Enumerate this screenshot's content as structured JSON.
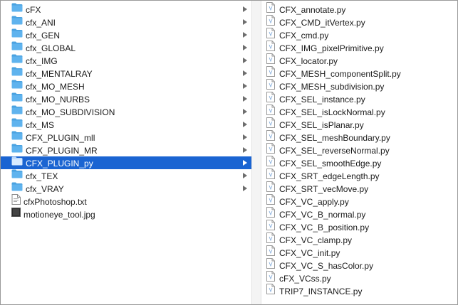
{
  "left_column": {
    "items": [
      {
        "label": "cFX",
        "type": "folder"
      },
      {
        "label": "cfx_ANI",
        "type": "folder"
      },
      {
        "label": "cfx_GEN",
        "type": "folder"
      },
      {
        "label": "cfx_GLOBAL",
        "type": "folder"
      },
      {
        "label": "cfx_IMG",
        "type": "folder"
      },
      {
        "label": "cfx_MENTALRAY",
        "type": "folder"
      },
      {
        "label": "cfx_MO_MESH",
        "type": "folder"
      },
      {
        "label": "cfx_MO_NURBS",
        "type": "folder"
      },
      {
        "label": "cfx_MO_SUBDIVISION",
        "type": "folder"
      },
      {
        "label": "cfx_MS",
        "type": "folder"
      },
      {
        "label": "CFX_PLUGIN_mll",
        "type": "folder"
      },
      {
        "label": "CFX_PLUGIN_MR",
        "type": "folder"
      },
      {
        "label": "CFX_PLUGIN_py",
        "type": "folder",
        "selected": true
      },
      {
        "label": "cfx_TEX",
        "type": "folder"
      },
      {
        "label": "cfx_VRAY",
        "type": "folder"
      },
      {
        "label": "cfxPhotoshop.txt",
        "type": "text-file"
      },
      {
        "label": "motioneye_tool.jpg",
        "type": "image-file"
      }
    ]
  },
  "right_column": {
    "items": [
      "CFX_annotate.py",
      "CFX_CMD_itVertex.py",
      "CFX_cmd.py",
      "CFX_IMG_pixelPrimitive.py",
      "CFX_locator.py",
      "CFX_MESH_componentSplit.py",
      "CFX_MESH_subdivision.py",
      "CFX_SEL_instance.py",
      "CFX_SEL_isLockNormal.py",
      "CFX_SEL_isPlanar.py",
      "CFX_SEL_meshBoundary.py",
      "CFX_SEL_reverseNormal.py",
      "CFX_SEL_smoothEdge.py",
      "CFX_SRT_edgeLength.py",
      "CFX_SRT_vecMove.py",
      "CFX_VC_apply.py",
      "CFX_VC_B_normal.py",
      "CFX_VC_B_position.py",
      "CFX_VC_clamp.py",
      "CFX_VC_init.py",
      "CFX_VC_S_hasColor.py",
      "cFX_VCss.py",
      "TRIP7_INSTANCE.py"
    ]
  },
  "colors": {
    "selection": "#1a64d2",
    "folder_body": "#5fb3ee",
    "folder_tab": "#4aa2e0",
    "chevron": "#6e6e6e"
  },
  "icons": {
    "folder": "folder-icon",
    "text_file": "text-file-icon",
    "image_file": "image-file-icon",
    "python_file": "python-file-icon",
    "disclosure": "chevron-right-icon"
  }
}
